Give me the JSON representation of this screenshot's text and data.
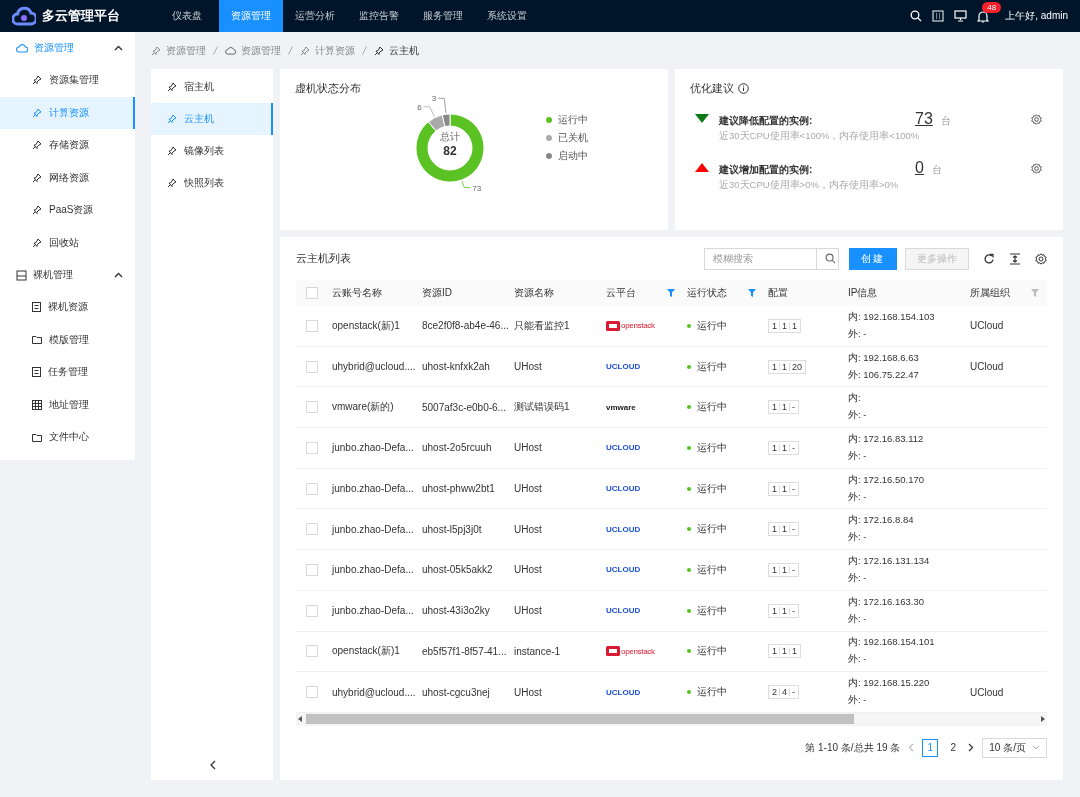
{
  "app": {
    "title": "多云管理平台"
  },
  "nav_tabs": [
    {
      "label": "仪表盘",
      "selected": false
    },
    {
      "label": "资源管理",
      "selected": true
    },
    {
      "label": "运营分析",
      "selected": false
    },
    {
      "label": "监控告警",
      "selected": false
    },
    {
      "label": "服务管理",
      "selected": false
    },
    {
      "label": "系统设置",
      "selected": false
    }
  ],
  "header": {
    "notification_count": "48",
    "greeting": "上午好, admin"
  },
  "sidebar": {
    "groups": [
      {
        "label": "资源管理",
        "expanded": true,
        "active": true,
        "items": [
          {
            "label": "资源集管理",
            "selected": false
          },
          {
            "label": "计算资源",
            "selected": true
          },
          {
            "label": "存储资源",
            "selected": false
          },
          {
            "label": "网络资源",
            "selected": false
          },
          {
            "label": "PaaS资源",
            "selected": false
          },
          {
            "label": "回收站",
            "selected": false
          }
        ]
      },
      {
        "label": "裸机管理",
        "expanded": true,
        "active": false,
        "items": [
          {
            "label": "裸机资源",
            "selected": false
          },
          {
            "label": "模版管理",
            "selected": false
          },
          {
            "label": "任务管理",
            "selected": false
          },
          {
            "label": "地址管理",
            "selected": false
          },
          {
            "label": "文件中心",
            "selected": false
          }
        ]
      }
    ]
  },
  "breadcrumb": [
    "资源管理",
    "资源管理",
    "计算资源",
    "云主机"
  ],
  "sub_nav": [
    {
      "label": "宿主机",
      "selected": false
    },
    {
      "label": "云主机",
      "selected": true
    },
    {
      "label": "镜像列表",
      "selected": false
    },
    {
      "label": "快照列表",
      "selected": false
    }
  ],
  "status_card": {
    "title": "虚机状态分布",
    "total_label": "总计",
    "total": "82",
    "chart_data": {
      "type": "donut",
      "categories": [
        "运行中",
        "已关机",
        "启动中"
      ],
      "values": [
        73,
        6,
        3
      ],
      "colors": [
        "#5ac323",
        "#aaaaaa",
        "#888888"
      ],
      "data_labels": true
    }
  },
  "optimization": {
    "title": "优化建议",
    "items": [
      {
        "kind": "down",
        "title": "建议降低配置的实例:",
        "count": "73",
        "unit": "台",
        "note": "近30天CPU使用率<100%，内存使用率<100%"
      },
      {
        "kind": "up",
        "title": "建议增加配置的实例:",
        "count": "0",
        "unit": "台",
        "note": "近30天CPU使用率>0%，内存使用率>0%"
      }
    ]
  },
  "table": {
    "title": "云主机列表",
    "all_checked": false,
    "search": {
      "placeholder": "模糊搜索"
    },
    "create_button": "创建",
    "more_button": {
      "label": "更多操作",
      "disabled": true
    },
    "columns": [
      {
        "label": "云账号名称"
      },
      {
        "label": "资源ID"
      },
      {
        "label": "资源名称"
      },
      {
        "label": "云平台",
        "filtered": true
      },
      {
        "label": "运行状态",
        "filtered": true
      },
      {
        "label": "配置"
      },
      {
        "label": "IP信息"
      },
      {
        "label": "所属组织",
        "filtered": false
      }
    ],
    "rows": [
      {
        "checked": false,
        "account": "openstack(新)1",
        "id": "8ce2f0f8-ab4e-46...",
        "name": "只能看监控1",
        "platform": {
          "kind": "openstack",
          "label": "openstack"
        },
        "status": "运行中",
        "config": [
          "1",
          "1",
          "1"
        ],
        "ip_in": "内: 192.168.154.103",
        "ip_out": "外: -",
        "org": "UCloud"
      },
      {
        "checked": false,
        "account": "uhybrid@ucloud....",
        "id": "uhost-knfxk2ah",
        "name": "UHost",
        "platform": {
          "kind": "ucloud",
          "label": "UCLOUD"
        },
        "status": "运行中",
        "config": [
          "1",
          "1",
          "20"
        ],
        "ip_in": "内: 192.168.6.63",
        "ip_out": "外: 106.75.22.47",
        "org": "UCloud"
      },
      {
        "checked": false,
        "account": "vmware(新的)",
        "id": "5007af3c-e0b0-6...",
        "name": "测试错误码1",
        "platform": {
          "kind": "vmware",
          "label": "vmware"
        },
        "status": "运行中",
        "config": [
          "1",
          "1",
          "-"
        ],
        "ip_in": "内:",
        "ip_out": "外: -"
      },
      {
        "checked": false,
        "account": "junbo.zhao-Defa...",
        "id": "uhost-2o5rcuuh",
        "name": "UHost",
        "platform": {
          "kind": "ucloud",
          "label": "UCLOUD"
        },
        "status": "运行中",
        "config": [
          "1",
          "1",
          "-"
        ],
        "ip_in": "内: 172.16.83.112",
        "ip_out": "外: -"
      },
      {
        "checked": false,
        "account": "junbo.zhao-Defa...",
        "id": "uhost-phww2bt1",
        "name": "UHost",
        "platform": {
          "kind": "ucloud",
          "label": "UCLOUD"
        },
        "status": "运行中",
        "config": [
          "1",
          "1",
          "-"
        ],
        "ip_in": "内: 172.16.50.170",
        "ip_out": "外: -"
      },
      {
        "checked": false,
        "account": "junbo.zhao-Defa...",
        "id": "uhost-l5pj3j0t",
        "name": "UHost",
        "platform": {
          "kind": "ucloud",
          "label": "UCLOUD"
        },
        "status": "运行中",
        "config": [
          "1",
          "1",
          "-"
        ],
        "ip_in": "内: 172.16.8.84",
        "ip_out": "外: -"
      },
      {
        "checked": false,
        "account": "junbo.zhao-Defa...",
        "id": "uhost-05k5akk2",
        "name": "UHost",
        "platform": {
          "kind": "ucloud",
          "label": "UCLOUD"
        },
        "status": "运行中",
        "config": [
          "1",
          "1",
          "-"
        ],
        "ip_in": "内: 172.16.131.134",
        "ip_out": "外: -"
      },
      {
        "checked": false,
        "account": "junbo.zhao-Defa...",
        "id": "uhost-43i3o2ky",
        "name": "UHost",
        "platform": {
          "kind": "ucloud",
          "label": "UCLOUD"
        },
        "status": "运行中",
        "config": [
          "1",
          "1",
          "-"
        ],
        "ip_in": "内: 172.16.163.30",
        "ip_out": "外: -"
      },
      {
        "checked": false,
        "account": "openstack(新)1",
        "id": "eb5f57f1-8f57-41...",
        "name": "instance-1",
        "platform": {
          "kind": "openstack",
          "label": "openstack"
        },
        "status": "运行中",
        "config": [
          "1",
          "1",
          "1"
        ],
        "ip_in": "内: 192.168.154.101",
        "ip_out": "外: -"
      },
      {
        "checked": false,
        "account": "uhybrid@ucloud....",
        "id": "uhost-cgcu3nej",
        "name": "UHost",
        "platform": {
          "kind": "ucloud",
          "label": "UCLOUD"
        },
        "status": "运行中",
        "config": [
          "2",
          "4",
          "-"
        ],
        "ip_in": "内: 192.168.15.220",
        "ip_out": "外: -",
        "org": "UCloud"
      }
    ]
  },
  "pagination": {
    "summary": "第 1-10 条/总共 19 条",
    "pages": [
      {
        "label": "1",
        "selected": true
      },
      {
        "label": "2",
        "selected": false
      }
    ],
    "page_size": "10 条/页"
  }
}
